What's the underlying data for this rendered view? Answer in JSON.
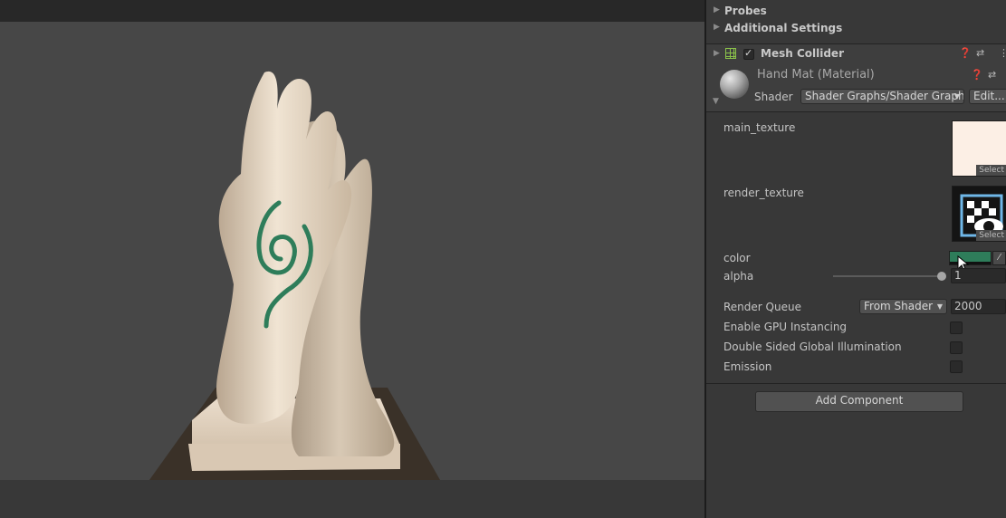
{
  "inspector": {
    "sections": [
      {
        "label": "Probes"
      },
      {
        "label": "Additional Settings"
      }
    ],
    "mesh_collider": {
      "title": "Mesh Collider",
      "enabled": true
    },
    "material": {
      "name": "Hand Mat (Material)",
      "shader_label": "Shader",
      "shader_value": "Shader Graphs/Shader Graph",
      "edit_label": "Edit..."
    },
    "properties": {
      "main_texture": {
        "label": "main_texture",
        "select_label": "Select"
      },
      "render_texture": {
        "label": "render_texture",
        "select_label": "Select"
      },
      "color": {
        "label": "color",
        "value_hex": "#2e7d5a"
      },
      "alpha": {
        "label": "alpha",
        "value": "1"
      },
      "render_queue": {
        "label": "Render Queue",
        "mode": "From Shader",
        "value": "2000"
      },
      "gpu_instancing": {
        "label": "Enable GPU Instancing",
        "checked": false
      },
      "double_sided_gi": {
        "label": "Double Sided Global Illumination",
        "checked": false
      },
      "emission": {
        "label": "Emission",
        "checked": false
      }
    },
    "add_component_label": "Add Component"
  },
  "colors": {
    "accent_green": "#2e7d5a",
    "skin": "#e9dccb",
    "pedestal": "#3a3128"
  }
}
